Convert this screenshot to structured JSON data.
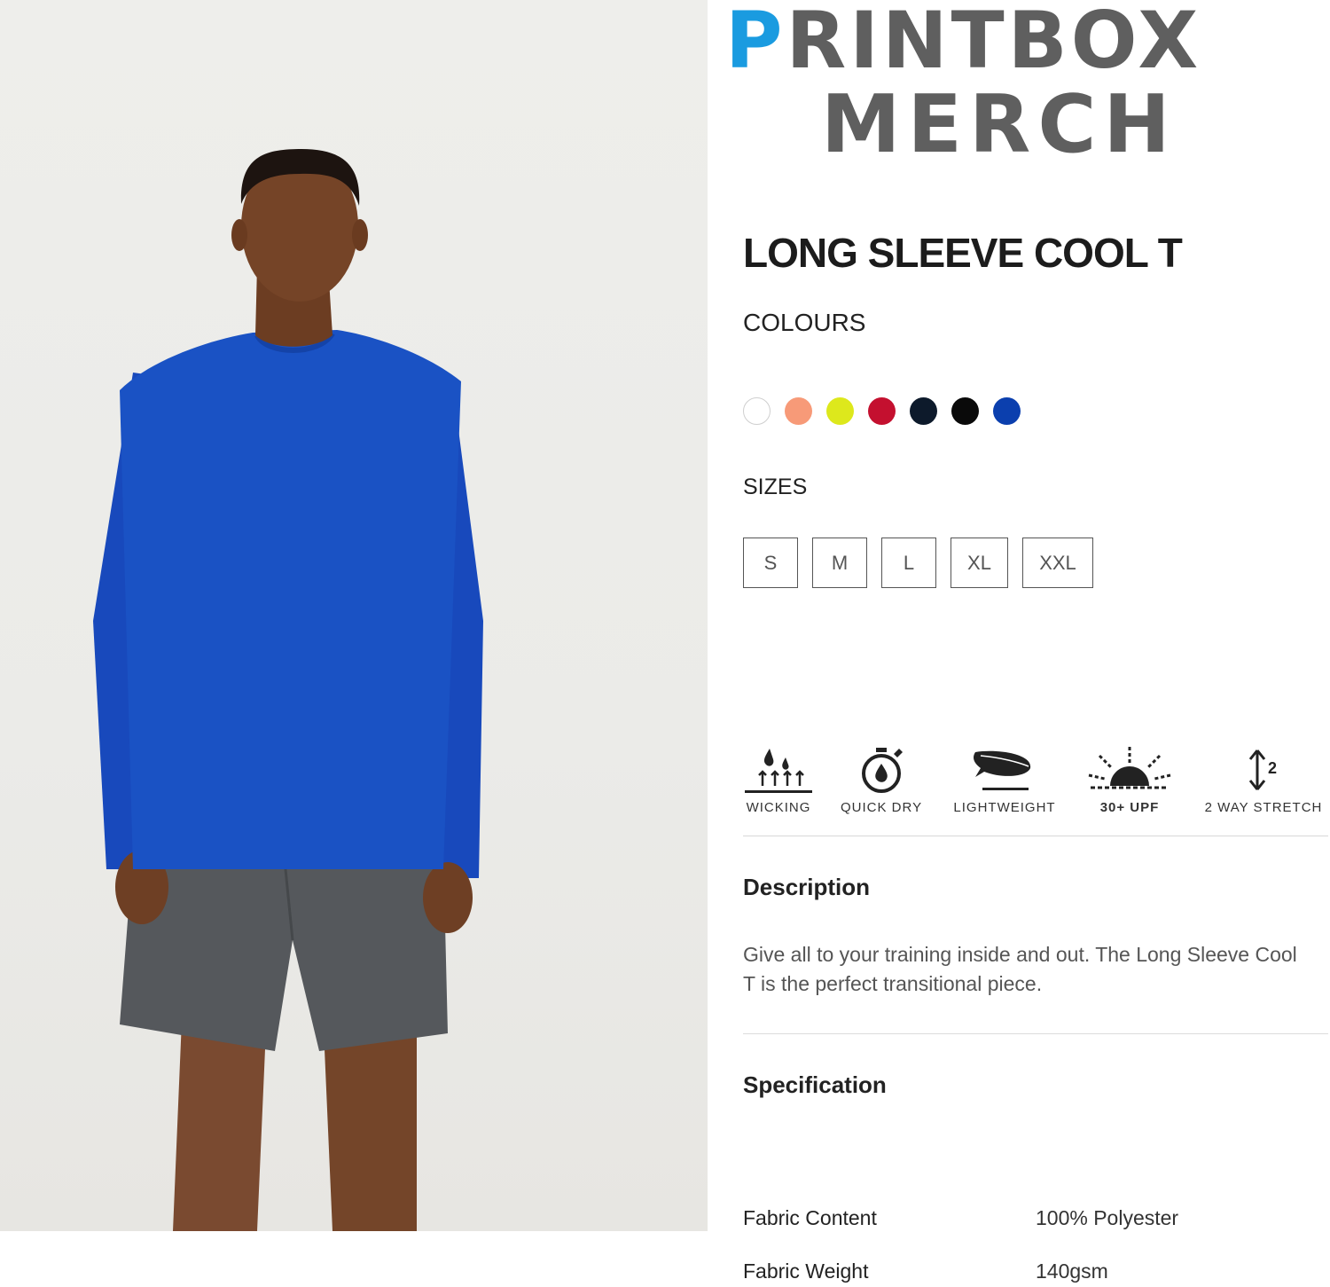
{
  "logo": {
    "line1_first": "P",
    "line1_rest": "RINTBOX",
    "line2": "MERCH"
  },
  "product": {
    "title": "LONG SLEEVE COOL T"
  },
  "colours": {
    "label": "COLOURS",
    "swatches": [
      "#ffffff",
      "#f79a78",
      "#dde81c",
      "#c4102f",
      "#0d1a2b",
      "#0a0a0a",
      "#0b3fae"
    ]
  },
  "sizes": {
    "label": "SIZES",
    "options": [
      "S",
      "M",
      "L",
      "XL",
      "XXL"
    ]
  },
  "features": [
    {
      "label": "WICKING",
      "icon": "wicking-icon"
    },
    {
      "label": "QUICK DRY",
      "icon": "stopwatch-drop-icon"
    },
    {
      "label": "LIGHTWEIGHT",
      "icon": "feather-icon"
    },
    {
      "label": "30+ UPF",
      "icon": "sun-icon"
    },
    {
      "label": "2 WAY STRETCH",
      "icon": "stretch-arrow-icon"
    }
  ],
  "description": {
    "heading": "Description",
    "text": "Give all to your training inside and out. The Long Sleeve Cool T is the perfect transitional piece."
  },
  "specification": {
    "heading": "Specification",
    "rows": [
      {
        "key": "Fabric Content",
        "value": "100% Polyester"
      },
      {
        "key": "Fabric Weight",
        "value": "140gsm"
      }
    ]
  },
  "colors": {
    "brand_blue": "#1a9be0",
    "brand_grey": "#5f5f5f",
    "shirt_blue": "#1a52c4",
    "shorts_grey": "#55585c"
  }
}
